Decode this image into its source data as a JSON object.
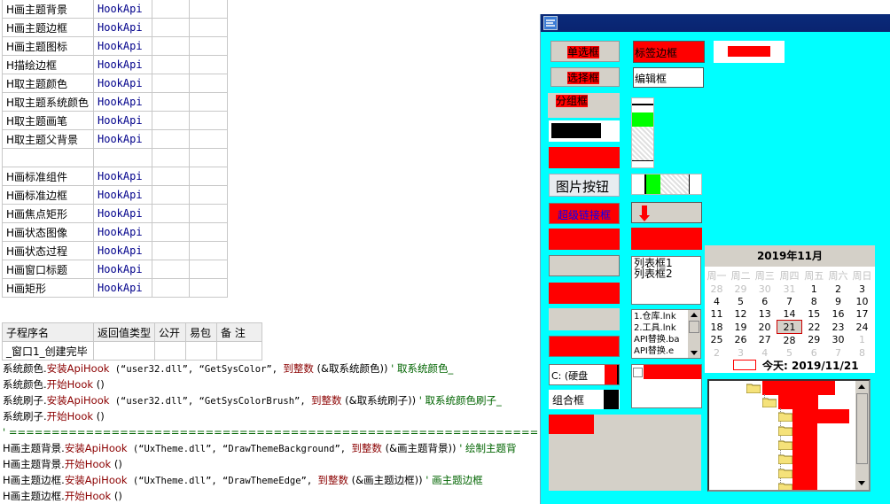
{
  "table1": {
    "rows": [
      {
        "name": "H画主题背景",
        "type": "HookApi"
      },
      {
        "name": "H画主题边框",
        "type": "HookApi"
      },
      {
        "name": "H画主题图标",
        "type": "HookApi"
      },
      {
        "name": "H描绘边框",
        "type": "HookApi"
      },
      {
        "name": "H取主题颜色",
        "type": "HookApi"
      },
      {
        "name": "H取主题系统颜色",
        "type": "HookApi"
      },
      {
        "name": "H取主题画笔",
        "type": "HookApi"
      },
      {
        "name": "H取主题父背景",
        "type": "HookApi"
      },
      {
        "name": "",
        "type": ""
      },
      {
        "name": "H画标准组件",
        "type": "HookApi"
      },
      {
        "name": "H画标准边框",
        "type": "HookApi"
      },
      {
        "name": "H画焦点矩形",
        "type": "HookApi"
      },
      {
        "name": "H画状态图像",
        "type": "HookApi"
      },
      {
        "name": "H画状态过程",
        "type": "HookApi"
      },
      {
        "name": "H画窗口标题",
        "type": "HookApi"
      },
      {
        "name": "H画矩形",
        "type": "HookApi"
      }
    ]
  },
  "sub_table": {
    "headers": [
      "子程序名",
      "返回值类型",
      "公开",
      "易包",
      "备 注"
    ],
    "row": "_窗口1_创建完毕"
  },
  "code": {
    "l1": {
      "a": "系统颜色.",
      "b": "安装ApiHook",
      "c": " (“user32.dll”, “GetSysColor”, ",
      "d": "到整数",
      "e": " (&取系统颜色)) ",
      "f": "' 取系统颜色_"
    },
    "l2": {
      "a": "系统颜色.",
      "b": "开始Hook",
      "c": " ()"
    },
    "l3": {
      "a": "系统刷子.",
      "b": "安装ApiHook",
      "c": " (“user32.dll”, “GetSysColorBrush”, ",
      "d": "到整数",
      "e": " (&取系统刷子)) ",
      "f": "' 取系统颜色刷子_"
    },
    "l4": {
      "a": "系统刷子.",
      "b": "开始Hook",
      "c": " ()"
    },
    "l5": "' ====================================================================================",
    "l6": {
      "a": "H画主题背景.",
      "b": "安装ApiHook",
      "c": " (“UxTheme.dll”, “DrawThemeBackground”, ",
      "d": "到整数",
      "e": " (&画主题背景)) ",
      "f": "' 绘制主题背"
    },
    "l7": {
      "a": "H画主题背景.",
      "b": "开始Hook",
      "c": " ()"
    },
    "l8": {
      "a": "H画主题边框.",
      "b": "安装ApiHook",
      "c": " (“UxTheme.dll”, “DrawThemeEdge”, ",
      "d": "到整数",
      "e": " (&画主题边框)) ",
      "f": "' 画主题边框"
    },
    "l9": {
      "a": "H画主题边框.",
      "b": "开始Hook",
      "c": " ()"
    }
  },
  "window": {
    "radio_label": "单选框",
    "tag_border_label": "标签边框",
    "checkbox_label": "选择框",
    "edit_value": "编辑框",
    "groupbox_label": "分组框",
    "pic_button_label": "图片按钮",
    "link_label": "超级链接框",
    "listbox_items": [
      "列表框1",
      "列表框2"
    ],
    "filelist_items": [
      "1.仓库.lnk",
      "2.工具.lnk",
      "API替换.ba",
      "API替换.e"
    ],
    "drive_value": "C: (硬盘",
    "combo_label": "组合框",
    "calendar": {
      "title": "2019年11月",
      "weekdays": [
        "周一",
        "周二",
        "周三",
        "周四",
        "周五",
        "周六",
        "周日"
      ],
      "weeks": [
        [
          "28",
          "29",
          "30",
          "31",
          "1",
          "2",
          "3"
        ],
        [
          "4",
          "5",
          "6",
          "7",
          "8",
          "9",
          "10"
        ],
        [
          "11",
          "12",
          "13",
          "14",
          "15",
          "16",
          "17"
        ],
        [
          "18",
          "19",
          "20",
          "21",
          "22",
          "23",
          "24"
        ],
        [
          "25",
          "26",
          "27",
          "28",
          "29",
          "30",
          "1"
        ],
        [
          "2",
          "3",
          "4",
          "5",
          "6",
          "7",
          "8"
        ]
      ],
      "today_label": "今天: 2019/11/21"
    }
  },
  "colors": {
    "accent_red": "#ff0000",
    "window_bg": "#00ffff",
    "title_blue": "#0a2470",
    "green": "#00ff00"
  }
}
